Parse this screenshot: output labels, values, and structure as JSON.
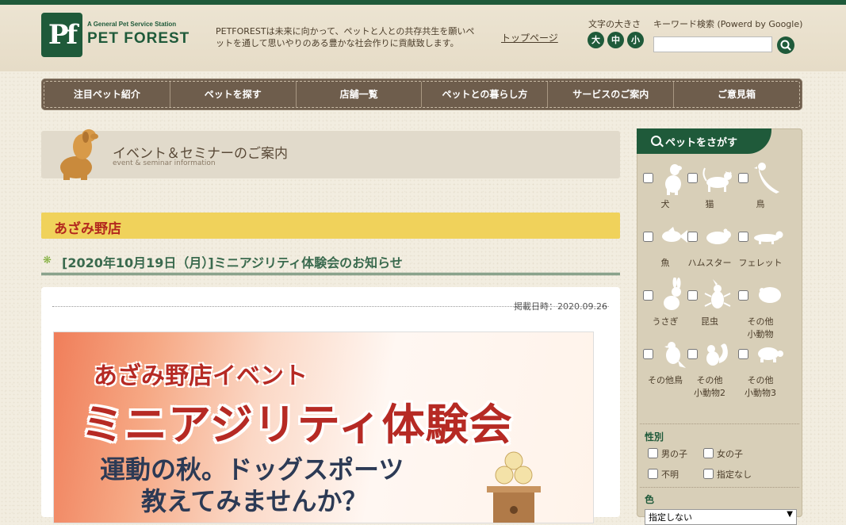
{
  "header": {
    "logo_mark": "Pf",
    "logo_tag": "A General Pet Service Station",
    "logo_name": "PET FOREST",
    "tagline": "PETFORESTは未来に向かって、ペットと人との共存共生を願いペットを通して思いやりのある豊かな社会作りに貢献致します。",
    "top_link": "トップページ",
    "font_size_label": "文字の大きさ",
    "font_sizes": [
      "大",
      "中",
      "小"
    ],
    "keyword_label": "キーワード検索 (Powerd by Google)",
    "keyword_value": "",
    "brand_color": "#1f5a3a"
  },
  "nav": {
    "items": [
      "注目ペット紹介",
      "ペットを探す",
      "店舗一覧",
      "ペットとの暮らし方",
      "サービスのご案内",
      "ご意見箱"
    ]
  },
  "page": {
    "title": "イベント＆セミナーのご案内",
    "subtitle": "event & seminar information",
    "store": "あざみ野店",
    "event_title": "[2020年10月19日（月）]ミニアジリティ体験会のお知らせ",
    "posted": "掲載日時：2020.09.26"
  },
  "poster": {
    "sub": "あざみ野店イベント",
    "main": "ミニアジリティ体験会",
    "line1": "運動の秋。ドッグスポーツ",
    "line2": "教えてみませんか？"
  },
  "sidebar": {
    "tab": "ペットをさがす",
    "animals": [
      {
        "label": "犬",
        "icon": "dog-icon"
      },
      {
        "label": "猫",
        "icon": "cat-icon"
      },
      {
        "label": "鳥",
        "icon": "bird-icon"
      },
      {
        "label": "魚",
        "icon": "fish-icon"
      },
      {
        "label": "ハムスター",
        "icon": "hamster-icon"
      },
      {
        "label": "フェレット",
        "icon": "ferret-icon"
      },
      {
        "label": "うさぎ",
        "icon": "rabbit-icon"
      },
      {
        "label": "昆虫",
        "icon": "beetle-icon"
      },
      {
        "label": "その他\n小動物",
        "icon": "small-animal-icon"
      },
      {
        "label": "その他鳥",
        "icon": "other-bird-icon"
      },
      {
        "label": "その他\n小動物2",
        "icon": "squirrel-icon"
      },
      {
        "label": "その他\n小動物3",
        "icon": "turtle-icon"
      }
    ],
    "gender_label": "性別",
    "genders": [
      "男の子",
      "女の子",
      "不明",
      "指定なし"
    ],
    "color_label": "色",
    "color_value": "指定しない"
  }
}
